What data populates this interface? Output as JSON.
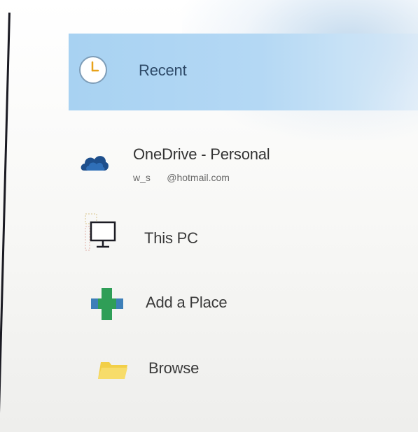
{
  "places": {
    "recent": {
      "label": "Recent",
      "icon": "clock-icon",
      "selected": true
    },
    "onedrive": {
      "label": "OneDrive - Personal",
      "account": "w_s      @hotmail.com",
      "icon": "onedrive-cloud-icon"
    },
    "this_pc": {
      "label": "This PC",
      "icon": "computer-monitor-icon"
    },
    "add_place": {
      "label": "Add a Place",
      "icon": "plus-icon"
    },
    "browse": {
      "label": "Browse",
      "icon": "folder-icon"
    }
  },
  "colors": {
    "selection": "#a8d2f2",
    "clock_accent": "#e8a21a",
    "onedrive_blue": "#1e4f8c",
    "plus_green": "#2f9e57",
    "folder_yellow": "#f2cf48",
    "divider": "#1a1a22"
  }
}
